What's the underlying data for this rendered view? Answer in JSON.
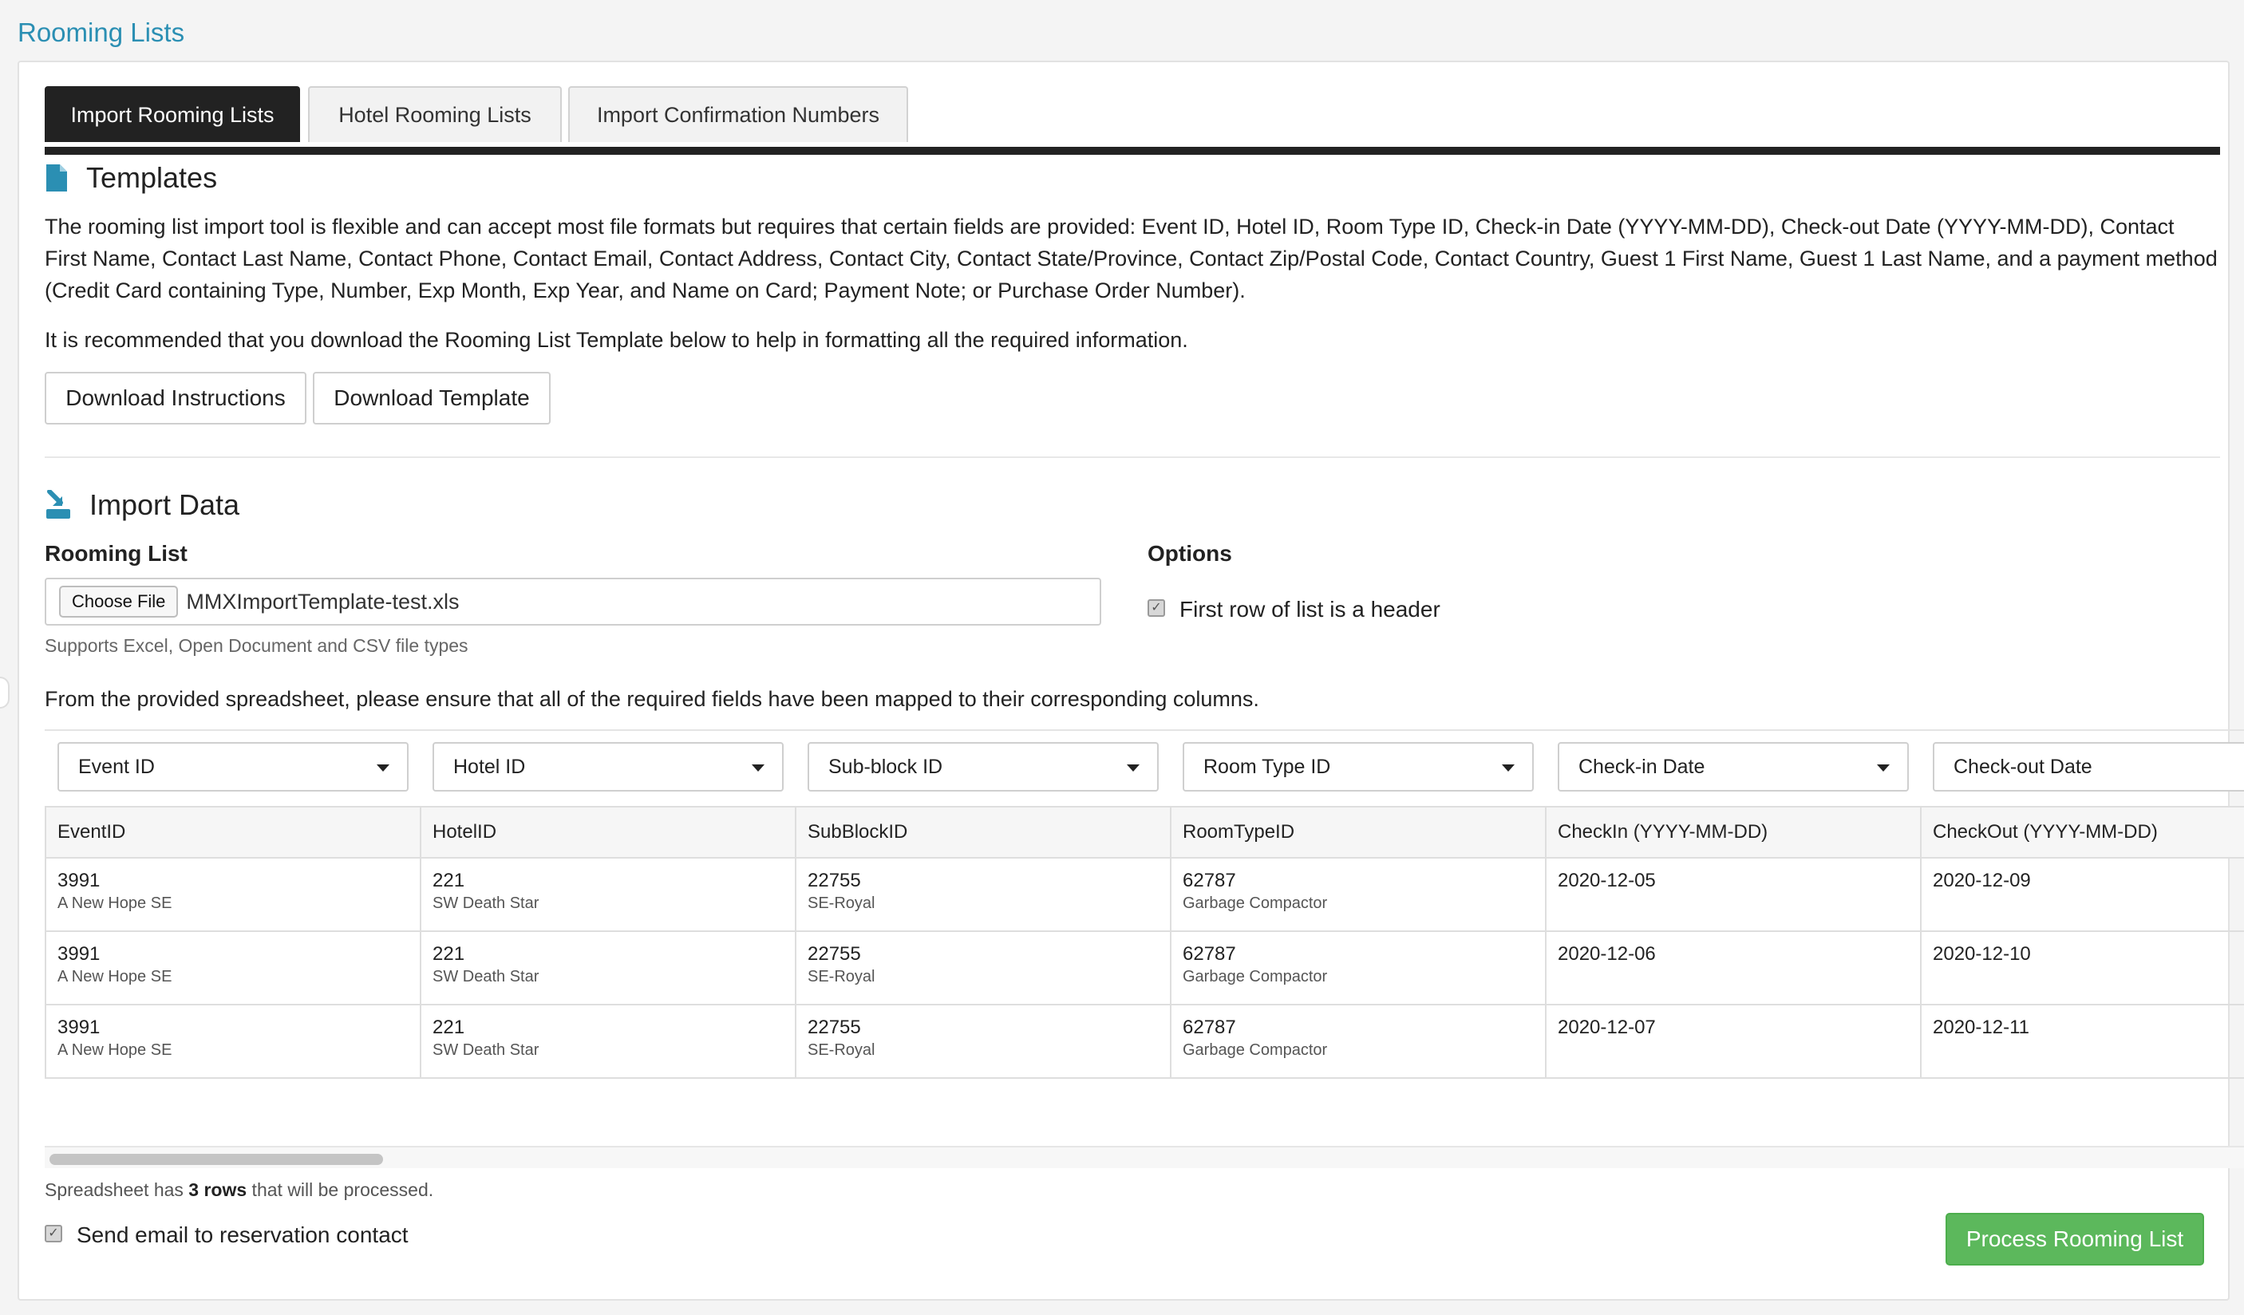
{
  "page": {
    "title": "Rooming Lists"
  },
  "tabs": [
    {
      "label": "Import Rooming Lists",
      "active": true
    },
    {
      "label": "Hotel Rooming Lists",
      "active": false
    },
    {
      "label": "Import Confirmation Numbers",
      "active": false
    }
  ],
  "templates": {
    "heading": "Templates",
    "icon": "file-icon",
    "description": "The rooming list import tool is flexible and can accept most file formats but requires that certain fields are provided: Event ID, Hotel ID, Room Type ID, Check-in Date (YYYY-MM-DD), Check-out Date (YYYY-MM-DD), Contact First Name, Contact Last Name, Contact Phone, Contact Email, Contact Address, Contact City, Contact State/Province, Contact Zip/Postal Code, Contact Country, Guest 1 First Name, Guest 1 Last Name, and a payment method (Credit Card containing Type, Number, Exp Month, Exp Year, and Name on Card; Payment Note; or Purchase Order Number).",
    "recommendation": "It is recommended that you download the Rooming List Template below to help in formatting all the required information.",
    "download_instructions_label": "Download Instructions",
    "download_template_label": "Download Template"
  },
  "import_data": {
    "heading": "Import Data",
    "icon": "import-icon",
    "rooming_list_label": "Rooming List",
    "choose_file_label": "Choose File",
    "file_name": "MMXImportTemplate-test.xls",
    "supports_text": "Supports Excel, Open Document and CSV file types",
    "options_label": "Options",
    "header_option_label": "First row of list is a header",
    "header_option_checked": true,
    "mapping_instruction": "From the provided spreadsheet, please ensure that all of the required fields have been mapped to their corresponding columns."
  },
  "mapping": {
    "selects": [
      "Event ID",
      "Hotel ID",
      "Sub-block ID",
      "Room Type ID",
      "Check-in Date",
      "Check-out Date"
    ],
    "columns": [
      "EventID",
      "HotelID",
      "SubBlockID",
      "RoomTypeID",
      "CheckIn (YYYY-MM-DD)",
      "CheckOut (YYYY-MM-DD)"
    ],
    "rows": [
      [
        {
          "v": "3991",
          "sub": "A New Hope SE"
        },
        {
          "v": "221",
          "sub": "SW Death Star"
        },
        {
          "v": "22755",
          "sub": "SE-Royal"
        },
        {
          "v": "62787",
          "sub": "Garbage Compactor"
        },
        {
          "v": "2020-12-05",
          "sub": ""
        },
        {
          "v": "2020-12-09",
          "sub": ""
        }
      ],
      [
        {
          "v": "3991",
          "sub": "A New Hope SE"
        },
        {
          "v": "221",
          "sub": "SW Death Star"
        },
        {
          "v": "22755",
          "sub": "SE-Royal"
        },
        {
          "v": "62787",
          "sub": "Garbage Compactor"
        },
        {
          "v": "2020-12-06",
          "sub": ""
        },
        {
          "v": "2020-12-10",
          "sub": ""
        }
      ],
      [
        {
          "v": "3991",
          "sub": "A New Hope SE"
        },
        {
          "v": "221",
          "sub": "SW Death Star"
        },
        {
          "v": "22755",
          "sub": "SE-Royal"
        },
        {
          "v": "62787",
          "sub": "Garbage Compactor"
        },
        {
          "v": "2020-12-07",
          "sub": ""
        },
        {
          "v": "2020-12-11",
          "sub": ""
        }
      ]
    ]
  },
  "footer": {
    "rows_prefix": "Spreadsheet has ",
    "rows_count": "3 rows",
    "rows_suffix": " that will be processed.",
    "send_email_label": "Send email to reservation contact",
    "send_email_checked": true,
    "process_label": "Process Rooming List",
    "process_color": "#5cb85c"
  },
  "colors": {
    "accent": "#2b8fb3",
    "tab_active": "#222222"
  }
}
